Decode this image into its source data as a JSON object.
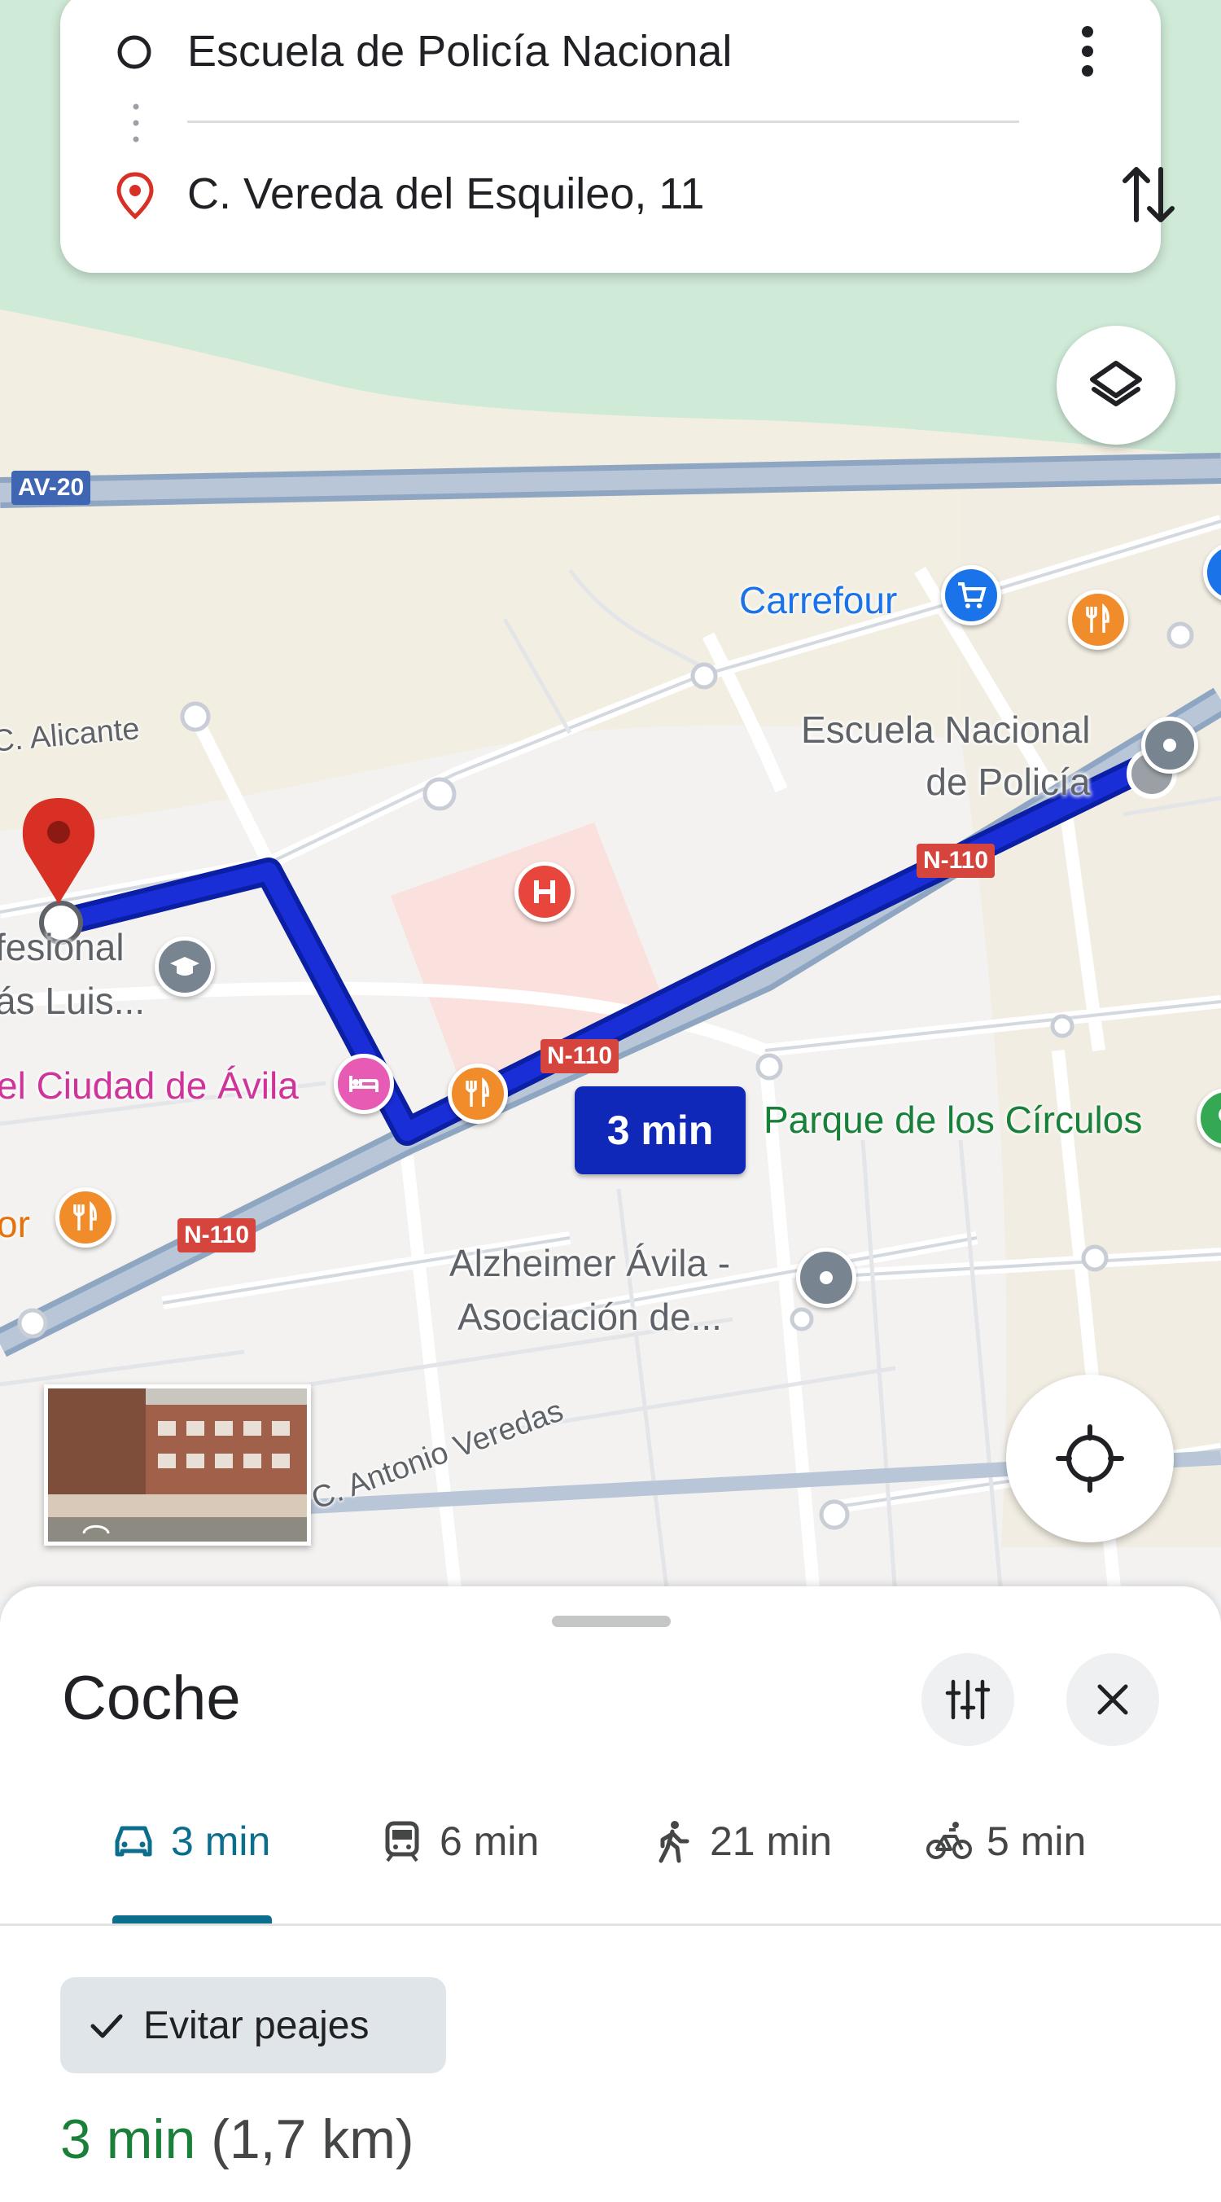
{
  "directions": {
    "origin": "Escuela de Policía Nacional",
    "destination": "C. Vereda del Esquileo, 11"
  },
  "map": {
    "road_shields": [
      "AV-20",
      "N-110",
      "N-110",
      "N-110"
    ],
    "streets": [
      "C. Alicante",
      "C. Antonio Veredas"
    ],
    "pois": {
      "carrefour": "Carrefour",
      "escuela": "Escuela Nacional\nde Policía",
      "parque": "Parque de los Círculos",
      "alzheimer": "Alzheimer Ávila -\nAsociación de...",
      "hotel": "el Ciudad de Ávila",
      "fesional": "fesional\nás Luis...",
      "or": "or"
    },
    "route_time": "3 min",
    "colors": {
      "route": "#1a2ed8",
      "route_outline": "#0b1fa5",
      "accent": "#0b6e8c"
    }
  },
  "sheet": {
    "title": "Coche",
    "modes": [
      {
        "name": "car",
        "icon": "car-icon",
        "label": "3 min",
        "active": true
      },
      {
        "name": "transit",
        "icon": "train-icon",
        "label": "6 min",
        "active": false
      },
      {
        "name": "walk",
        "icon": "walk-icon",
        "label": "21 min",
        "active": false
      },
      {
        "name": "bike",
        "icon": "bike-icon",
        "label": "5 min",
        "active": false
      }
    ],
    "chip_label": "Evitar peajes",
    "summary_time": "3 min",
    "summary_distance": "(1,7 km)"
  }
}
